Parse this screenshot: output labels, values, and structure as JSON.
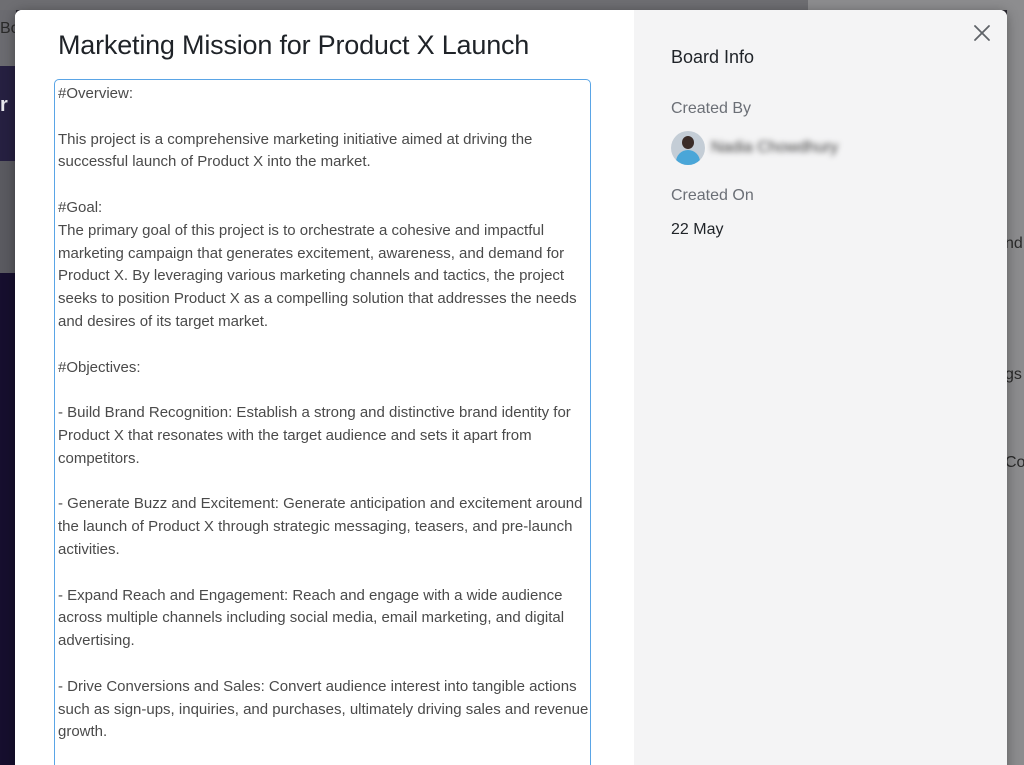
{
  "modal": {
    "title": "Marketing Mission for Product X Launch",
    "description": "#Overview:\n\nThis project is a comprehensive marketing initiative aimed at driving the successful launch of Product X into the market.\n\n#Goal:\nThe primary goal of this project is to orchestrate a cohesive and impactful marketing campaign that generates excitement, awareness, and demand for Product X. By leveraging various marketing channels and tactics, the project seeks to position Product X as a compelling solution that addresses the needs and desires of its target market.\n\n#Objectives:\n\n- Build Brand Recognition: Establish a strong and distinctive brand identity for Product X that resonates with the target audience and sets it apart from competitors.\n\n- Generate Buzz and Excitement: Generate anticipation and excitement around the launch of Product X through strategic messaging, teasers, and pre-launch activities.\n\n- Expand Reach and Engagement: Reach and engage with a wide audience across multiple channels including social media, email marketing, and digital advertising.\n\n- Drive Conversions and Sales: Convert audience interest into tangible actions such as sign-ups, inquiries, and purchases, ultimately driving sales and revenue growth.",
    "close_icon": "close-icon"
  },
  "board_info": {
    "heading": "Board Info",
    "created_by_label": "Created By",
    "created_by_name": "Nadia Chowdhury",
    "created_on_label": "Created On",
    "created_on_value": "22 May"
  },
  "background": {
    "peek_top_left": "Bo",
    "peek_left_bold": "r",
    "peek_right_1": "nd",
    "peek_right_2": "gs",
    "peek_right_3": "Co"
  },
  "colors": {
    "focus_border": "#5aa5e6",
    "side_panel_bg": "#f4f4f5"
  }
}
